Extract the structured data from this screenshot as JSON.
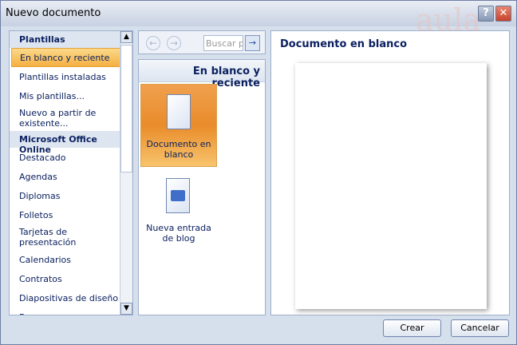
{
  "window": {
    "title": "Nuevo documento",
    "help": "?",
    "close": "✕",
    "watermark": "aula Clic"
  },
  "sidebar": {
    "sections": [
      {
        "label": "Plantillas",
        "items": [
          "En blanco y reciente",
          "Plantillas instaladas",
          "Mis plantillas...",
          "Nuevo a partir de existente..."
        ]
      },
      {
        "label": "Microsoft Office Online",
        "items": [
          "Destacado",
          "Agendas",
          "Diplomas",
          "Folletos",
          "Tarjetas de presentación",
          "Calendarios",
          "Contratos",
          "Diapositivas de diseño",
          "Faxes"
        ]
      }
    ],
    "selected": "En blanco y reciente"
  },
  "nav": {
    "back": "←",
    "forward": "→",
    "search_placeholder": "Buscar pl",
    "go": "→"
  },
  "middle": {
    "heading": "En blanco y reciente",
    "tiles": [
      "Documento en blanco",
      "Nueva entrada de blog"
    ]
  },
  "preview": {
    "title": "Documento en blanco"
  },
  "buttons": {
    "create": "Crear",
    "cancel": "Cancelar"
  }
}
